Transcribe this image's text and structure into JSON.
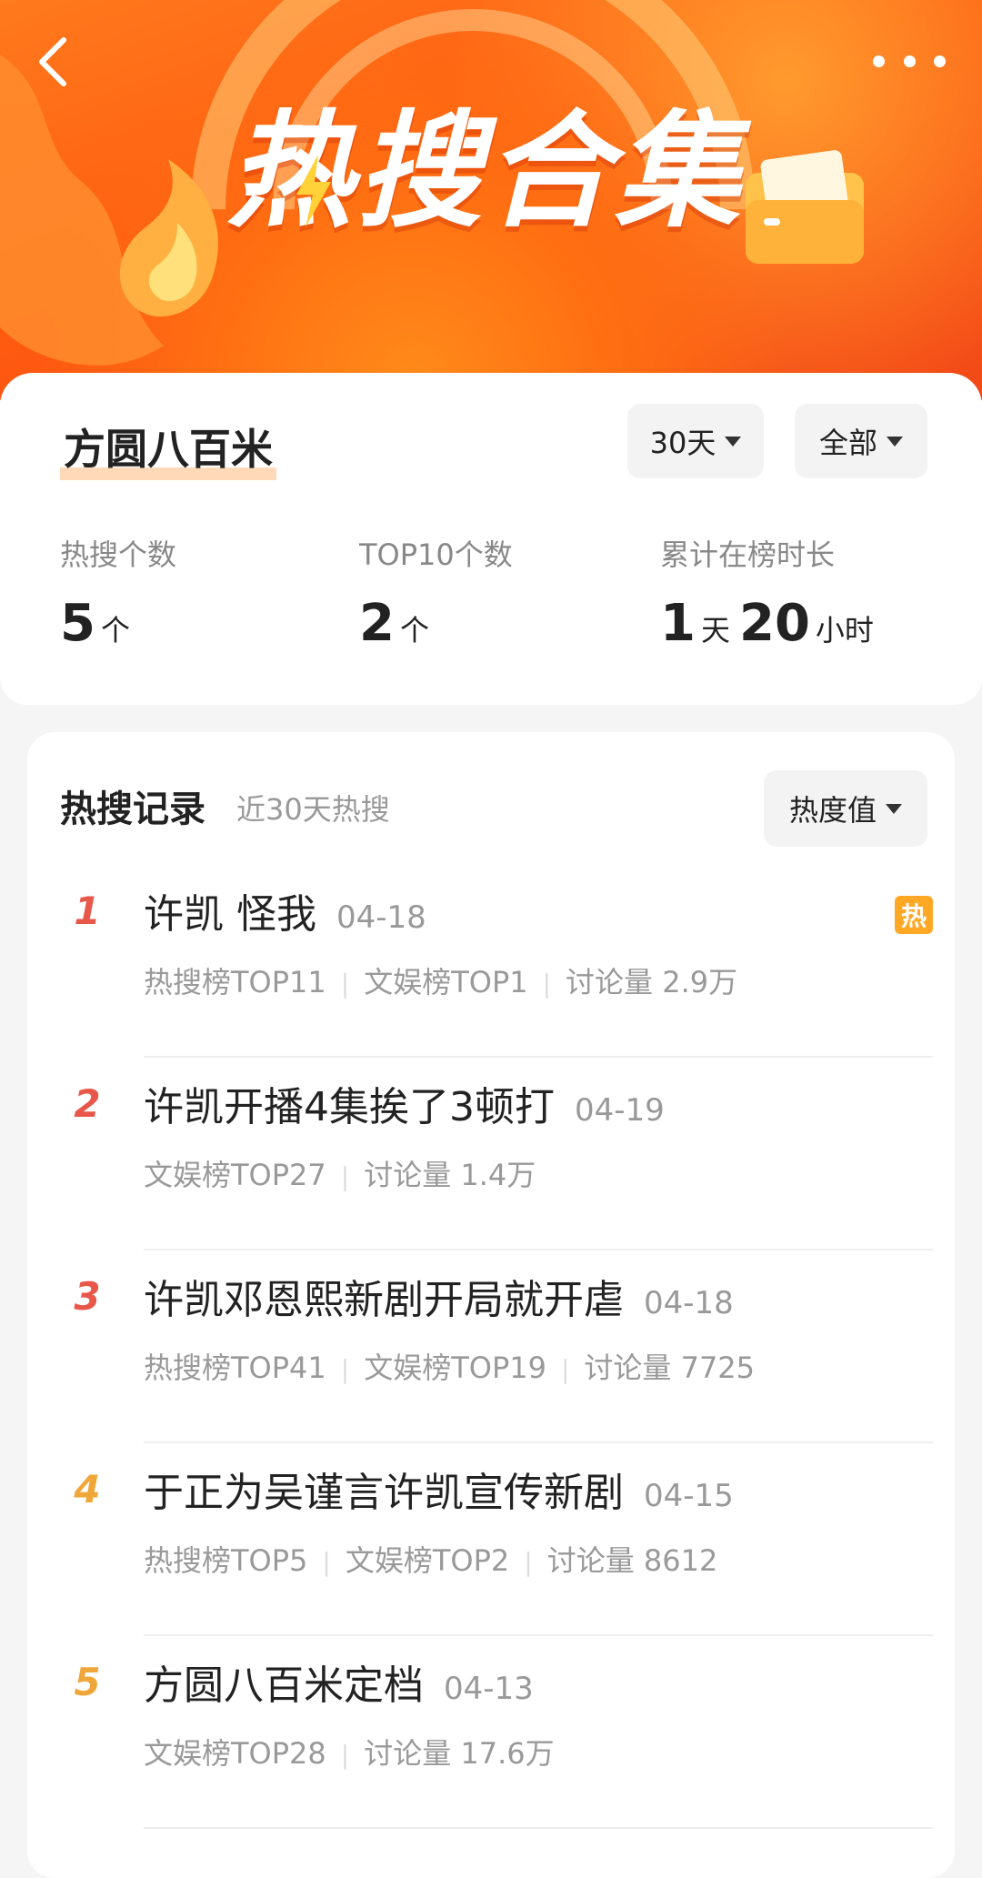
{
  "banner": {
    "title": "热搜合集",
    "back_icon": "chevron-left-icon",
    "more_icon": "more-dots-icon"
  },
  "summary": {
    "name": "方圆八百米",
    "period_filter": "30天",
    "category_filter": "全部",
    "stats": [
      {
        "label": "热搜个数",
        "value": "5",
        "unit": "个"
      },
      {
        "label": "TOP10个数",
        "value": "2",
        "unit": "个"
      },
      {
        "label": "累计在榜时长",
        "days": "1",
        "days_unit": "天",
        "hours": "20",
        "hours_unit": "小时"
      }
    ]
  },
  "records": {
    "title": "热搜记录",
    "subtitle": "近30天热搜",
    "sort_filter": "热度值",
    "items": [
      {
        "rank": "1",
        "title": "许凯 怪我",
        "date": "04-18",
        "meta": [
          "热搜榜TOP11",
          "文娱榜TOP1",
          "讨论量 2.9万"
        ],
        "badge": "热",
        "rank_color": "#e8574a"
      },
      {
        "rank": "2",
        "title": "许凯开播4集挨了3顿打",
        "date": "04-19",
        "meta": [
          "文娱榜TOP27",
          "讨论量 1.4万"
        ],
        "rank_color": "#e8574a"
      },
      {
        "rank": "3",
        "title": "许凯邓恩熙新剧开局就开虐",
        "date": "04-18",
        "meta": [
          "热搜榜TOP41",
          "文娱榜TOP19",
          "讨论量 7725"
        ],
        "rank_color": "#e8574a"
      },
      {
        "rank": "4",
        "title": "于正为吴谨言许凯宣传新剧",
        "date": "04-15",
        "meta": [
          "热搜榜TOP5",
          "文娱榜TOP2",
          "讨论量 8612"
        ],
        "rank_color": "#f0a73a"
      },
      {
        "rank": "5",
        "title": "方圆八百米定档",
        "date": "04-13",
        "meta": [
          "文娱榜TOP28",
          "讨论量 17.6万"
        ],
        "rank_color": "#f0a73a"
      }
    ]
  },
  "colors": {
    "accent": "#ff6a14",
    "badge": "#ffa826"
  }
}
